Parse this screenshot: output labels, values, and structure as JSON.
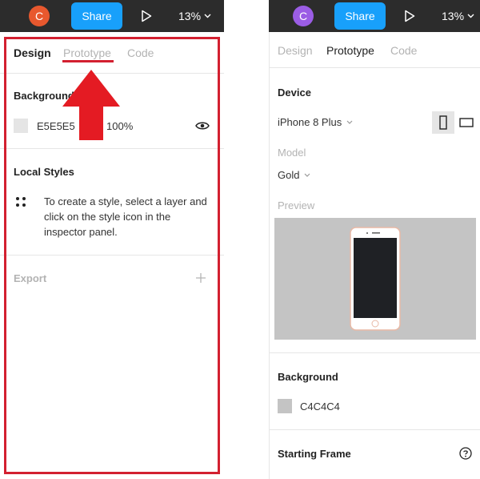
{
  "left": {
    "toolbar": {
      "avatar_letter": "C",
      "avatar_color": "#e8582e",
      "share_label": "Share",
      "zoom": "13%"
    },
    "tabs": [
      {
        "label": "Design",
        "active": true
      },
      {
        "label": "Prototype",
        "active": false
      },
      {
        "label": "Code",
        "active": false
      }
    ],
    "background": {
      "title": "Background",
      "color_hex": "E5E5E5",
      "opacity": "100%",
      "swatch_color": "#e5e5e5"
    },
    "local_styles": {
      "title": "Local Styles",
      "help_text": "To create a style, select a layer and click on the style icon in the inspector panel."
    },
    "export": {
      "title": "Export"
    }
  },
  "right": {
    "toolbar": {
      "avatar_letter": "C",
      "avatar_color": "#9b5de5",
      "share_label": "Share",
      "zoom": "13%"
    },
    "tabs": [
      {
        "label": "Design",
        "active": false
      },
      {
        "label": "Prototype",
        "active": true
      },
      {
        "label": "Code",
        "active": false
      }
    ],
    "device": {
      "title": "Device",
      "selected": "iPhone 8 Plus"
    },
    "model": {
      "label": "Model",
      "selected": "Gold"
    },
    "preview": {
      "label": "Preview"
    },
    "background": {
      "title": "Background",
      "color_hex": "C4C4C4",
      "swatch_color": "#c4c4c4"
    },
    "starting_frame": {
      "title": "Starting Frame"
    }
  },
  "colors": {
    "toolbar_bg": "#2c2c2c",
    "share_blue": "#18a0fb",
    "highlight_red": "#d32030",
    "preview_bg": "#c4c4c4"
  }
}
